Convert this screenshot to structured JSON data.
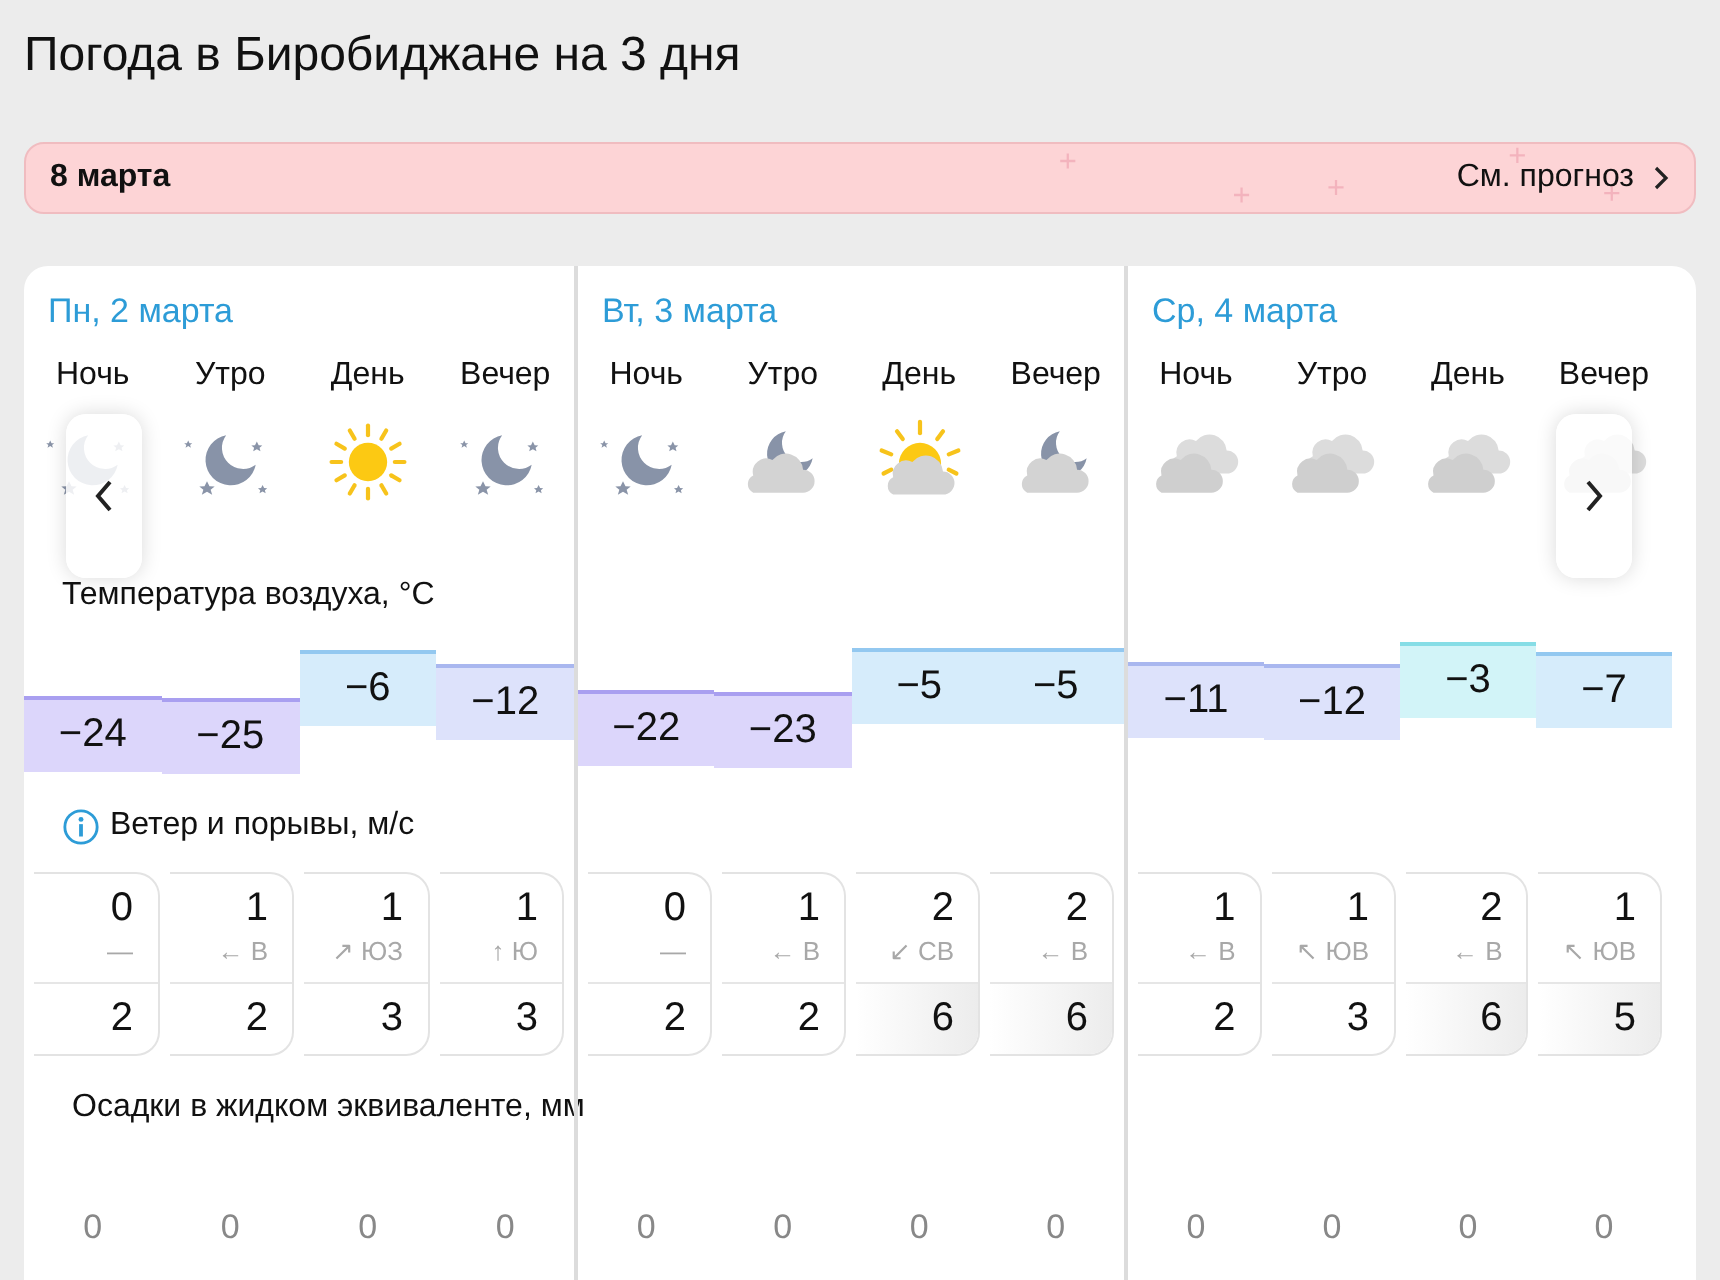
{
  "title": "Погода в Биробиджане на 3 дня",
  "banner": {
    "date": "8 марта",
    "link": "См. прогноз"
  },
  "temperature_label": "Температура воздуха, °C",
  "wind_label": "Ветер и порывы, м/с",
  "precip_label": "Осадки в жидком эквиваленте, мм",
  "days": [
    {
      "date": "Пн, 2 марта",
      "periods": [
        {
          "name": "Ночь",
          "kind": "night-clear",
          "temp": "−24",
          "wind": "0",
          "direction": "—",
          "gust": "2",
          "strong_gust": false,
          "precip": "0"
        },
        {
          "name": "Утро",
          "kind": "night-clear",
          "temp": "−25",
          "wind": "1",
          "direction": "← В",
          "gust": "2",
          "strong_gust": false,
          "precip": "0"
        },
        {
          "name": "День",
          "kind": "sun",
          "temp": "−6",
          "wind": "1",
          "direction": "↗ ЮЗ",
          "gust": "3",
          "strong_gust": false,
          "precip": "0"
        },
        {
          "name": "Вечер",
          "kind": "night-clear",
          "temp": "−12",
          "wind": "1",
          "direction": "↑ Ю",
          "gust": "3",
          "strong_gust": false,
          "precip": "0"
        }
      ]
    },
    {
      "date": "Вт, 3 марта",
      "periods": [
        {
          "name": "Ночь",
          "kind": "night-clear",
          "temp": "−22",
          "wind": "0",
          "direction": "—",
          "gust": "2",
          "strong_gust": false,
          "precip": "0"
        },
        {
          "name": "Утро",
          "kind": "night-cloudy",
          "temp": "−23",
          "wind": "1",
          "direction": "← В",
          "gust": "2",
          "strong_gust": false,
          "precip": "0"
        },
        {
          "name": "День",
          "kind": "sun-cloudy",
          "temp": "−5",
          "wind": "2",
          "direction": "↙ СВ",
          "gust": "6",
          "strong_gust": true,
          "precip": "0"
        },
        {
          "name": "Вечер",
          "kind": "night-cloudy",
          "temp": "−5",
          "wind": "2",
          "direction": "← В",
          "gust": "6",
          "strong_gust": true,
          "precip": "0"
        }
      ]
    },
    {
      "date": "Ср, 4 марта",
      "periods": [
        {
          "name": "Ночь",
          "kind": "overcast",
          "temp": "−11",
          "wind": "1",
          "direction": "← В",
          "gust": "2",
          "strong_gust": false,
          "precip": "0"
        },
        {
          "name": "Утро",
          "kind": "overcast",
          "temp": "−12",
          "wind": "1",
          "direction": "↖ ЮВ",
          "gust": "3",
          "strong_gust": false,
          "precip": "0"
        },
        {
          "name": "День",
          "kind": "overcast",
          "temp": "−3",
          "wind": "2",
          "direction": "← В",
          "gust": "6",
          "strong_gust": true,
          "precip": "0"
        },
        {
          "name": "Вечер",
          "kind": "overcast",
          "temp": "−7",
          "wind": "1",
          "direction": "↖ ЮВ",
          "gust": "5",
          "strong_gust": true,
          "precip": "0"
        }
      ]
    }
  ]
}
